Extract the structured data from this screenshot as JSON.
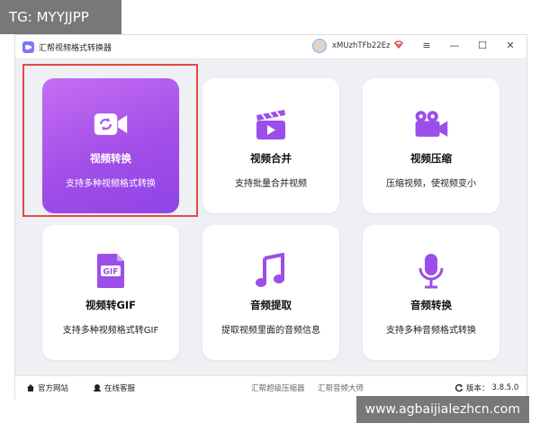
{
  "watermark_top": "TG: MYYJJPP",
  "watermark_bottom": "www.agbaijialezhcn.com",
  "window": {
    "title": "汇帮视频格式转换器",
    "username": "xMUzhTFb22Ez",
    "minimize": "—",
    "menu": "≡",
    "maximize": "☐",
    "close": "✕"
  },
  "cards": [
    {
      "title": "视频转换",
      "desc": "支持多种视频格式转换",
      "icon": "video-convert-icon",
      "active": true
    },
    {
      "title": "视频合并",
      "desc": "支持批量合并视频",
      "icon": "clapperboard-icon"
    },
    {
      "title": "视频压缩",
      "desc": "压缩视频，使视频变小",
      "icon": "video-camera-icon"
    },
    {
      "title": "视频转GIF",
      "desc": "支持多种视频格式转GIF",
      "icon": "gif-file-icon"
    },
    {
      "title": "音频提取",
      "desc": "提取视频里面的音频信息",
      "icon": "music-note-icon"
    },
    {
      "title": "音频转换",
      "desc": "支持多种音频格式转换",
      "icon": "microphone-icon"
    }
  ],
  "footer": {
    "website": "官方网站",
    "support": "在线客服",
    "link1": "汇帮超级压缩器",
    "link2": "汇帮音频大师",
    "version_label": "版本：",
    "version": "3.8.5.0"
  },
  "colors": {
    "accent": "#a34ee8",
    "highlight": "#e44a4a",
    "icon_purple": "#9b4ee9"
  }
}
